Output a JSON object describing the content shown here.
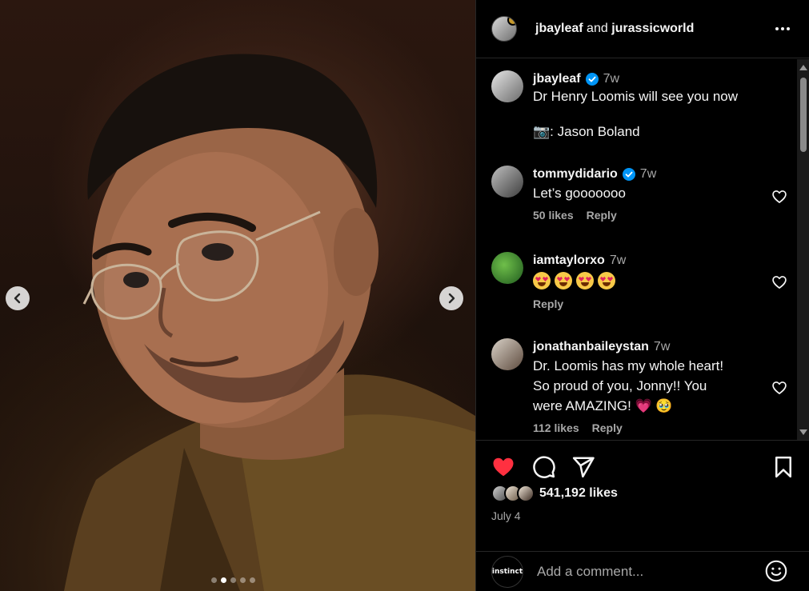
{
  "post": {
    "header_user1": "jbayleaf",
    "header_and": "and",
    "header_user2": "jurassicworld",
    "carousel_dots": 5,
    "active_dot": 1
  },
  "caption": {
    "username": "jbayleaf",
    "time": "7w",
    "text": "Dr Henry Loomis will see you now\n\n📷: Jason Boland"
  },
  "comments": [
    {
      "username": "tommydidario",
      "verified": true,
      "time": "7w",
      "text": "Let’s gooooooo",
      "likes": "50 likes",
      "reply": "Reply"
    },
    {
      "username": "iamtaylorxo",
      "verified": false,
      "time": "7w",
      "text": "",
      "emojis": [
        "heart-eyes-emoji",
        "heart-eyes-emoji",
        "heart-eyes-emoji",
        "heart-eyes-emoji"
      ],
      "likes": "",
      "reply": "Reply"
    },
    {
      "username": "jonathanbaileystan",
      "verified": false,
      "time": "7w",
      "text": "Dr. Loomis has my whole heart!\nSo proud of you, Jonny!! You\nwere AMAZING! 💗 🥹",
      "likes": "112 likes",
      "reply": "Reply"
    }
  ],
  "stats": {
    "likes": "541,192 likes",
    "date": "July 4"
  },
  "add_comment": {
    "avatar_text": "instinct",
    "placeholder": "Add a comment..."
  },
  "colors": {
    "like_red": "#ff3040",
    "verified_blue": "#0095f6",
    "muted": "#a8a8a8",
    "border": "#262626"
  }
}
